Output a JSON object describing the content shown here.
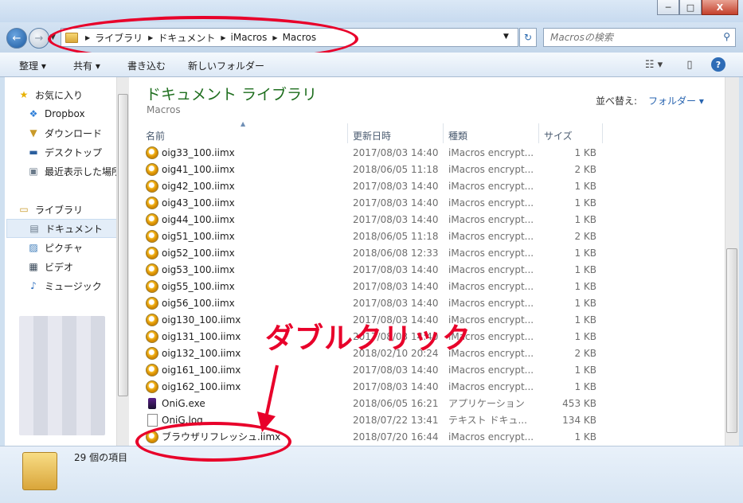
{
  "window": {
    "minimize_glyph": "─",
    "maximize_glyph": "□",
    "close_glyph": "X"
  },
  "nav": {
    "back_glyph": "←",
    "forward_glyph": "→",
    "dropdown_glyph": "▼",
    "breadcrumbs": [
      "ライブラリ",
      "ドキュメント",
      "iMacros",
      "Macros"
    ],
    "search_placeholder": "Macrosの検索",
    "refresh_glyph": "↻",
    "search_glyph": "⚲"
  },
  "toolbar": {
    "organize_label": "整理 ▾",
    "share_label": "共有 ▾",
    "burn_label": "書き込む",
    "new_folder_label": "新しいフォルダー",
    "view_glyph": "☷ ▾",
    "pane_glyph": "▯",
    "help_glyph": "?"
  },
  "sidebar": {
    "favorites_label": "お気に入り",
    "favorites": [
      "Dropbox",
      "ダウンロード",
      "デスクトップ",
      "最近表示した場所"
    ],
    "libraries_label": "ライブラリ",
    "libraries": [
      "ドキュメント",
      "ピクチャ",
      "ビデオ",
      "ミュージック"
    ],
    "selected": "ドキュメント"
  },
  "library": {
    "title": "ドキュメント ライブラリ",
    "subtitle": "Macros",
    "sort_label": "並べ替え:",
    "sort_value": "フォルダー ▾"
  },
  "columns": {
    "name": "名前",
    "date": "更新日時",
    "type": "種類",
    "size": "サイズ"
  },
  "files": [
    {
      "name": "oig33_100.iimx",
      "date": "2017/08/03 14:40",
      "type": "iMacros encrypt...",
      "size": "1 KB",
      "icon": "macro"
    },
    {
      "name": "oig41_100.iimx",
      "date": "2018/06/05 11:18",
      "type": "iMacros encrypt...",
      "size": "2 KB",
      "icon": "macro"
    },
    {
      "name": "oig42_100.iimx",
      "date": "2017/08/03 14:40",
      "type": "iMacros encrypt...",
      "size": "1 KB",
      "icon": "macro"
    },
    {
      "name": "oig43_100.iimx",
      "date": "2017/08/03 14:40",
      "type": "iMacros encrypt...",
      "size": "1 KB",
      "icon": "macro"
    },
    {
      "name": "oig44_100.iimx",
      "date": "2017/08/03 14:40",
      "type": "iMacros encrypt...",
      "size": "1 KB",
      "icon": "macro"
    },
    {
      "name": "oig51_100.iimx",
      "date": "2018/06/05 11:18",
      "type": "iMacros encrypt...",
      "size": "2 KB",
      "icon": "macro"
    },
    {
      "name": "oig52_100.iimx",
      "date": "2018/06/08 12:33",
      "type": "iMacros encrypt...",
      "size": "1 KB",
      "icon": "macro"
    },
    {
      "name": "oig53_100.iimx",
      "date": "2017/08/03 14:40",
      "type": "iMacros encrypt...",
      "size": "1 KB",
      "icon": "macro"
    },
    {
      "name": "oig55_100.iimx",
      "date": "2017/08/03 14:40",
      "type": "iMacros encrypt...",
      "size": "1 KB",
      "icon": "macro"
    },
    {
      "name": "oig56_100.iimx",
      "date": "2017/08/03 14:40",
      "type": "iMacros encrypt...",
      "size": "1 KB",
      "icon": "macro"
    },
    {
      "name": "oig130_100.iimx",
      "date": "2017/08/03 14:40",
      "type": "iMacros encrypt...",
      "size": "1 KB",
      "icon": "macro"
    },
    {
      "name": "oig131_100.iimx",
      "date": "2017/08/03 14:40",
      "type": "iMacros encrypt...",
      "size": "1 KB",
      "icon": "macro"
    },
    {
      "name": "oig132_100.iimx",
      "date": "2018/02/10 20:24",
      "type": "iMacros encrypt...",
      "size": "2 KB",
      "icon": "macro"
    },
    {
      "name": "oig161_100.iimx",
      "date": "2017/08/03 14:40",
      "type": "iMacros encrypt...",
      "size": "1 KB",
      "icon": "macro"
    },
    {
      "name": "oig162_100.iimx",
      "date": "2017/08/03 14:40",
      "type": "iMacros encrypt...",
      "size": "1 KB",
      "icon": "macro"
    },
    {
      "name": "OniG.exe",
      "date": "2018/06/05 16:21",
      "type": "アプリケーション",
      "size": "453 KB",
      "icon": "exe"
    },
    {
      "name": "OniG.log",
      "date": "2018/07/22 13:41",
      "type": "テキスト ドキュ...",
      "size": "134 KB",
      "icon": "log"
    },
    {
      "name": "ブラウザリフレッシュ.iimx",
      "date": "2018/07/20 16:44",
      "type": "iMacros encrypt...",
      "size": "1 KB",
      "icon": "macro"
    }
  ],
  "status": {
    "count": "29 個の項目"
  },
  "annotation": {
    "text": "ダブルクリック",
    "color": "#e8002a"
  }
}
